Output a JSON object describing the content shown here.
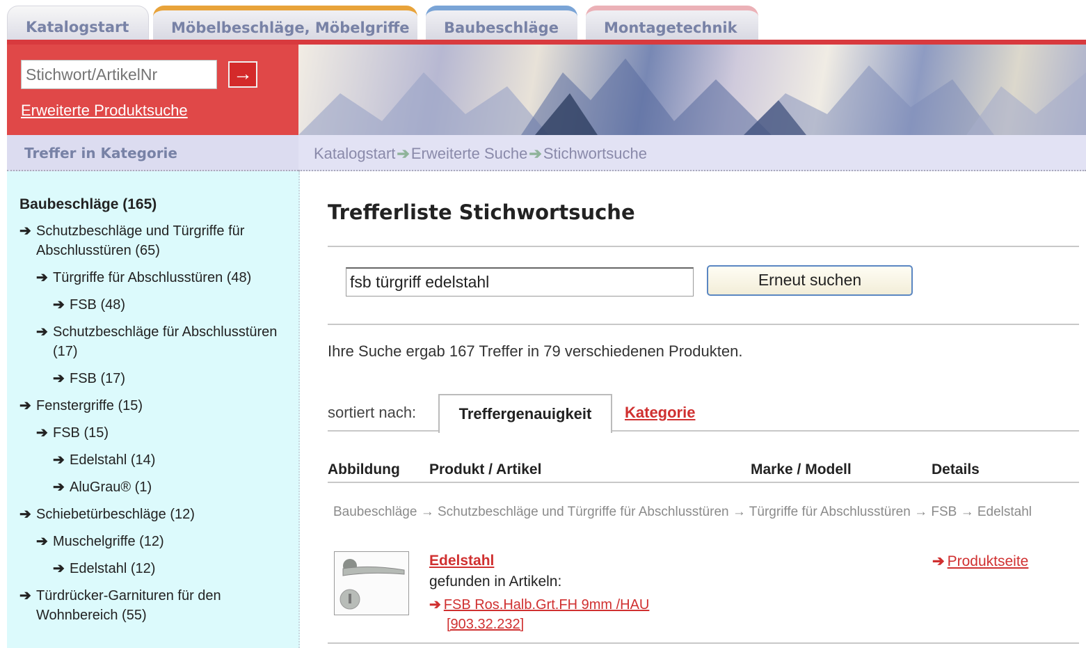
{
  "tabs": [
    "Katalogstart",
    "Möbelbeschläge, Möbelgriffe",
    "Baubeschläge",
    "Montagetechnik"
  ],
  "search": {
    "placeholder": "Stichwort/ArtikelNr",
    "go": "→",
    "advanced": "Erweiterte Produktsuche"
  },
  "sidebar_title": "Treffer in Kategorie",
  "breadcrumb": [
    "Katalogstart",
    "Erweiterte Suche",
    "Stichwortsuche"
  ],
  "categories": {
    "heading": "Baubeschläge (165)",
    "items": [
      {
        "level": 1,
        "label": "Schutzbeschläge und Türgriffe für Abschlusstüren (65)"
      },
      {
        "level": 2,
        "label": "Türgriffe für Abschlusstüren (48)"
      },
      {
        "level": 3,
        "label": "FSB (48)"
      },
      {
        "level": 2,
        "label": "Schutzbeschläge für Abschlusstüren (17)"
      },
      {
        "level": 3,
        "label": "FSB (17)"
      },
      {
        "level": 1,
        "label": "Fenstergriffe (15)"
      },
      {
        "level": 2,
        "label": "FSB (15)"
      },
      {
        "level": 3,
        "label": "Edelstahl (14)"
      },
      {
        "level": 3,
        "label": "AluGrau® (1)"
      },
      {
        "level": 1,
        "label": "Schiebetürbeschläge (12)"
      },
      {
        "level": 2,
        "label": "Muschelgriffe (12)"
      },
      {
        "level": 3,
        "label": "Edelstahl (12)"
      },
      {
        "level": 1,
        "label": "Türdrücker-Garnituren für den Wohnbereich (55)"
      }
    ]
  },
  "main": {
    "title": "Trefferliste Stichwortsuche",
    "query": "fsb türgriff edelstahl",
    "search_again": "Erneut suchen",
    "result_text": "Ihre Suche ergab 167 Treffer in 79 verschiedenen Produkten.",
    "sort_label": "sortiert nach:",
    "sort_active": "Treffergenauigkeit",
    "sort_other": "Kategorie",
    "columns": [
      "Abbildung",
      "Produkt / Artikel",
      "Marke / Modell",
      "Details"
    ],
    "result": {
      "path": "Baubeschläge → Schutzbeschläge und Türgriffe für Abschlusstüren → Türgriffe für Abschlusstüren → FSB → Edelstahl",
      "product": "Edelstahl",
      "found_in": "gefunden in Artikeln:",
      "article_line1": "FSB Ros.Halb.Grt.FH 9mm /HAU",
      "article_line2": "[903.32.232]",
      "details_link": "Produktseite"
    }
  },
  "colors": {
    "accent_red": "#d83a3e",
    "sidebar_bg": "#dcfafc",
    "tab_text": "#7882a6"
  }
}
